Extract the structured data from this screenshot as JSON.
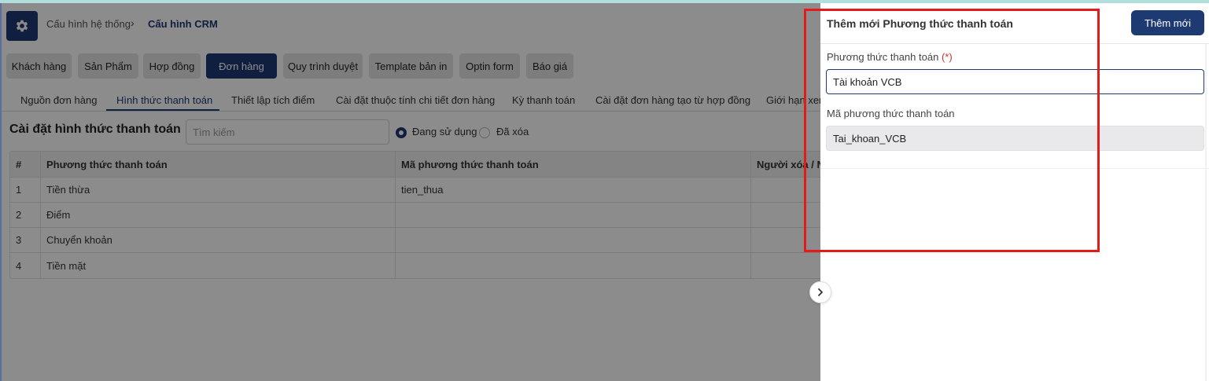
{
  "breadcrumb": {
    "parent": "Cấu hình hệ thống",
    "current": "Cấu hình CRM"
  },
  "main_tabs": [
    {
      "label": "Khách hàng"
    },
    {
      "label": "Sản Phẩm"
    },
    {
      "label": "Hợp đồng"
    },
    {
      "label": "Đơn hàng",
      "active": true
    },
    {
      "label": "Quy trình duyệt"
    },
    {
      "label": "Template bản in"
    },
    {
      "label": "Optin form"
    },
    {
      "label": "Báo giá"
    }
  ],
  "sub_tabs": [
    {
      "label": "Nguồn đơn hàng"
    },
    {
      "label": "Hình thức thanh toán",
      "active": true
    },
    {
      "label": "Thiết lập tích điểm"
    },
    {
      "label": "Cài đặt thuộc tính chi tiết đơn hàng"
    },
    {
      "label": "Kỳ thanh toán"
    },
    {
      "label": "Cài đặt đơn hàng tạo từ hợp đồng"
    },
    {
      "label": "Giới hạn xem"
    }
  ],
  "section": {
    "title": "Cài đặt hình thức thanh toán",
    "search_placeholder": "Tìm kiếm",
    "filter_active": "Đang sử dụng",
    "filter_deleted": "Đã xóa"
  },
  "table": {
    "headers": [
      "#",
      "Phương thức thanh toán",
      "Mã phương thức thanh toán",
      "Người xóa / Ngày xóa"
    ],
    "rows": [
      [
        "1",
        "Tiền thừa",
        "tien_thua",
        ""
      ],
      [
        "2",
        "Điểm",
        "",
        ""
      ],
      [
        "3",
        "Chuyển khoản",
        "",
        ""
      ],
      [
        "4",
        "Tiền mặt",
        "",
        ""
      ]
    ]
  },
  "drawer": {
    "title": "Thêm mới Phương thức thanh toán",
    "add_button": "Thêm mới",
    "method_label": "Phương thức thanh toán",
    "required_mark": "(*)",
    "method_value": "Tài khoản VCB",
    "code_label": "Mã phương thức thanh toán",
    "code_value": "Tai_khoan_VCB"
  },
  "colors": {
    "primary": "#1e3a73",
    "highlight": "#e41b1b",
    "required": "#d32f2f"
  },
  "icons": {
    "settings": "gear-icon",
    "breadcrumb_separator": "chevron-right-icon",
    "collapse": "chevron-right-icon"
  }
}
